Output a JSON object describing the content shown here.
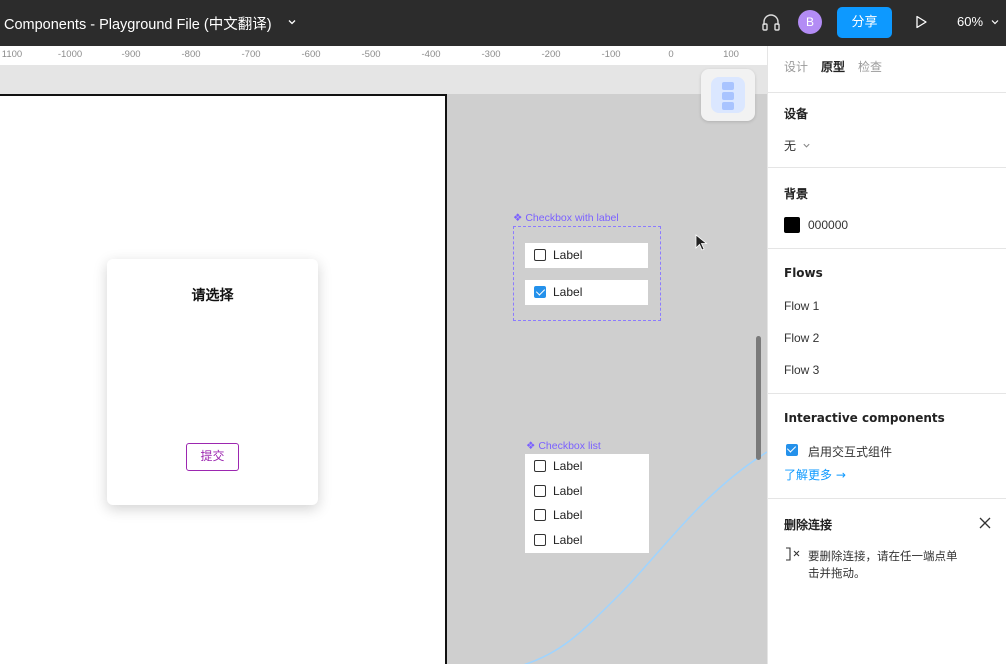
{
  "topbar": {
    "title": "Components - Playground File (中文翻译)",
    "avatar_letter": "B",
    "share_label": "分享",
    "zoom": "60%",
    "bg_color": "#2c2c2c",
    "accent": "#0d99ff"
  },
  "ruler": {
    "ticks": [
      "1100",
      "-1000",
      "-900",
      "-800",
      "-700",
      "-600",
      "-500",
      "-400",
      "-300",
      "-200",
      "-100",
      "0",
      "100"
    ]
  },
  "canvas": {
    "card": {
      "title": "请选择",
      "submit_label": "提交"
    },
    "checkbox_with_label": {
      "component_name": "❖ Checkbox with label",
      "rows": [
        {
          "label": "Label",
          "checked": false
        },
        {
          "label": "Label",
          "checked": true
        }
      ]
    },
    "checkbox_list": {
      "component_name": "❖ Checkbox list",
      "rows": [
        {
          "label": "Label",
          "checked": false
        },
        {
          "label": "Label",
          "checked": false
        },
        {
          "label": "Label",
          "checked": false
        },
        {
          "label": "Label",
          "checked": false
        }
      ]
    }
  },
  "panel": {
    "tabs": [
      "设计",
      "原型",
      "检查"
    ],
    "active_tab": "原型",
    "device": {
      "title": "设备",
      "value": "无"
    },
    "background": {
      "title": "背景",
      "hex": "000000"
    },
    "flows": {
      "title": "Flows",
      "items": [
        "Flow 1",
        "Flow 2",
        "Flow 3"
      ]
    },
    "interactive": {
      "title": "Interactive components",
      "checkbox_label": "启用交互式组件",
      "learn_more": "了解更多 →"
    },
    "delete_connection": {
      "title": "删除连接",
      "hint_line1": "要删除连接，请在任一端点单",
      "hint_line2": "击并拖动。"
    }
  }
}
